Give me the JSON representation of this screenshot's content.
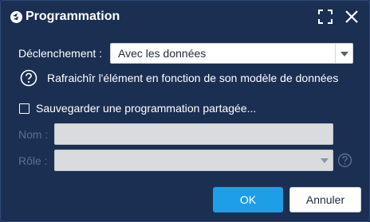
{
  "dialog": {
    "title": "Programmation",
    "icons": {
      "app": "app-logo-icon",
      "maximize": "maximize-icon",
      "close": "close-icon"
    }
  },
  "trigger": {
    "label": "Déclenchement :",
    "value": "Avec les données",
    "help_text": "Rafraichîr l'élément en fonction de son modèle de données"
  },
  "share": {
    "checkbox_label": "Sauvegarder une programmation partagée...",
    "checked": false,
    "name_label": "Nom :",
    "name_value": "",
    "role_label": "Rôle :",
    "role_value": ""
  },
  "buttons": {
    "ok": "OK",
    "cancel": "Annuler"
  },
  "colors": {
    "background": "#1b2f52",
    "accent": "#1e9ee6",
    "disabled_text": "#5c6f91"
  }
}
